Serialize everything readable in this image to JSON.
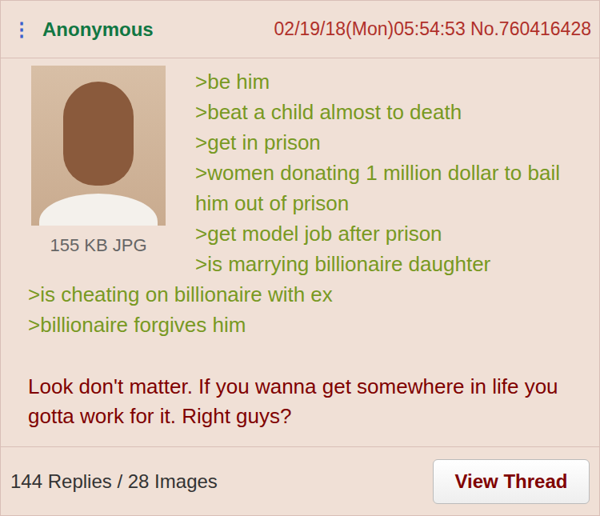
{
  "post": {
    "menu_icon": "⋮",
    "name": "Anonymous",
    "datetime": "02/19/18(Mon)05:54:53",
    "number": "No.760416428",
    "file_info": "155 KB JPG",
    "greentext": [
      ">be him",
      ">beat a child almost to death",
      ">get in prison",
      ">women donating 1 million dollar to bail him out of prison",
      ">get model job after prison",
      ">is marrying billionaire daughter",
      ">is cheating on billionaire with ex",
      ">billionaire forgives him"
    ],
    "message": "Look don't matter. If you wanna get somewhere in life you gotta work for it. Right guys?"
  },
  "footer": {
    "stats": "144 Replies / 28 Images",
    "button": "View Thread"
  }
}
